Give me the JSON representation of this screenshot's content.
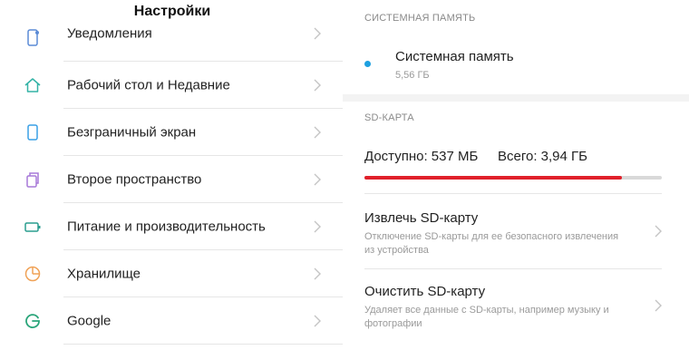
{
  "settings": {
    "title": "Настройки",
    "items": [
      {
        "label": "Уведомления",
        "icon": "notification-icon"
      },
      {
        "label": "Рабочий стол и Недавние",
        "icon": "home-icon"
      },
      {
        "label": "Безграничный экран",
        "icon": "phone-icon"
      },
      {
        "label": "Второе пространство",
        "icon": "copy-icon"
      },
      {
        "label": "Питание и производительность",
        "icon": "battery-icon"
      },
      {
        "label": "Хранилище",
        "icon": "storage-pie-icon"
      },
      {
        "label": "Google",
        "icon": "google-icon"
      }
    ]
  },
  "storage": {
    "system_section_title": "СИСТЕМНАЯ ПАМЯТЬ",
    "system_label": "Системная память",
    "system_size": "5,56 ГБ",
    "sd_section_title": "SD-КАРТА",
    "available": "Доступно: 537 МБ",
    "total": "Всего: 3,94 ГБ",
    "used_fraction": 0.866,
    "eject_title": "Извлечь SD-карту",
    "eject_desc": "Отключение SD-карты для ее безопасного извлечения из устройства",
    "clear_title": "Очистить SD-карту",
    "clear_desc": "Удаляет все данные с SD-карты, например музыку и фотографии"
  },
  "colors": {
    "accent_blue": "#1ea0e0",
    "bar_red": "#e0202b",
    "icon_teal": "#33b3a6",
    "icon_purple": "#a779d8",
    "icon_orange": "#f0a257",
    "icon_green": "#2a9d8f"
  }
}
